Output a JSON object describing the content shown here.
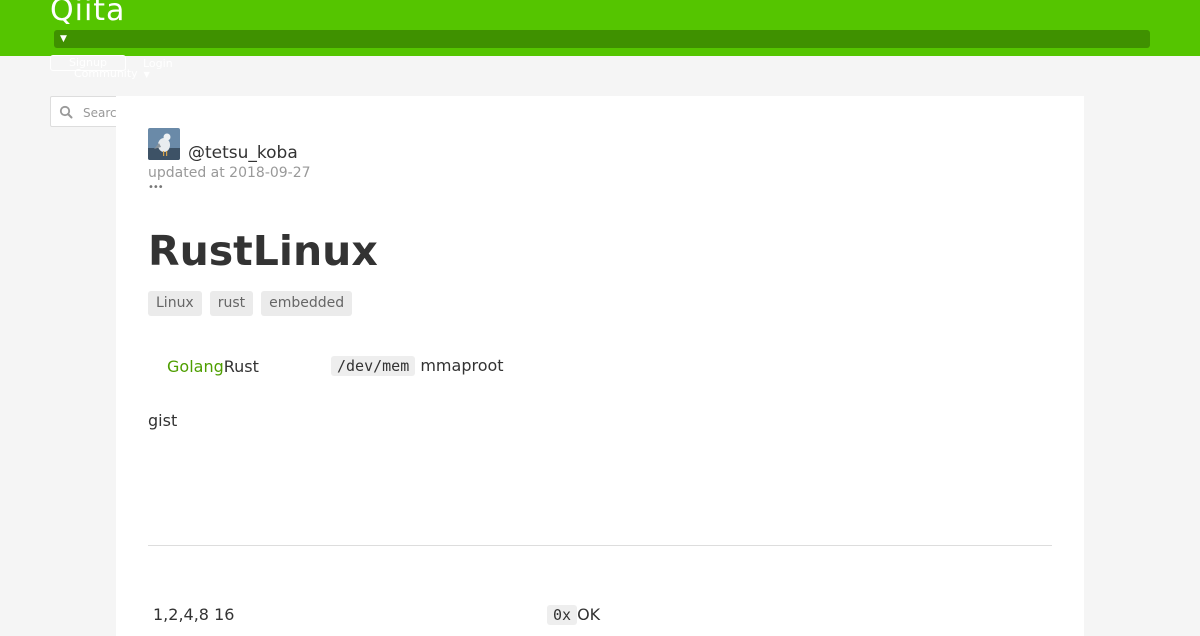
{
  "header": {
    "logo": "Qiita",
    "signup_label": "Signup",
    "login_label": "Login",
    "community_label": "Community",
    "colors": {
      "brand": "#55c500",
      "bar": "#3f9100"
    }
  },
  "search": {
    "placeholder": "Search"
  },
  "article": {
    "author": "@tetsu_koba",
    "updated": "updated at 2018-09-27",
    "more": "•••",
    "title": "RustLinux",
    "tags": [
      "Linux",
      "rust",
      "embedded"
    ],
    "para1": {
      "link": "Golang",
      "text": "Rust",
      "code": "/dev/mem",
      "after": " mmaproot"
    },
    "para2": "gist",
    "para3": {
      "text": "1,2,4,8 16",
      "code": "0x",
      "after": "OK"
    }
  }
}
